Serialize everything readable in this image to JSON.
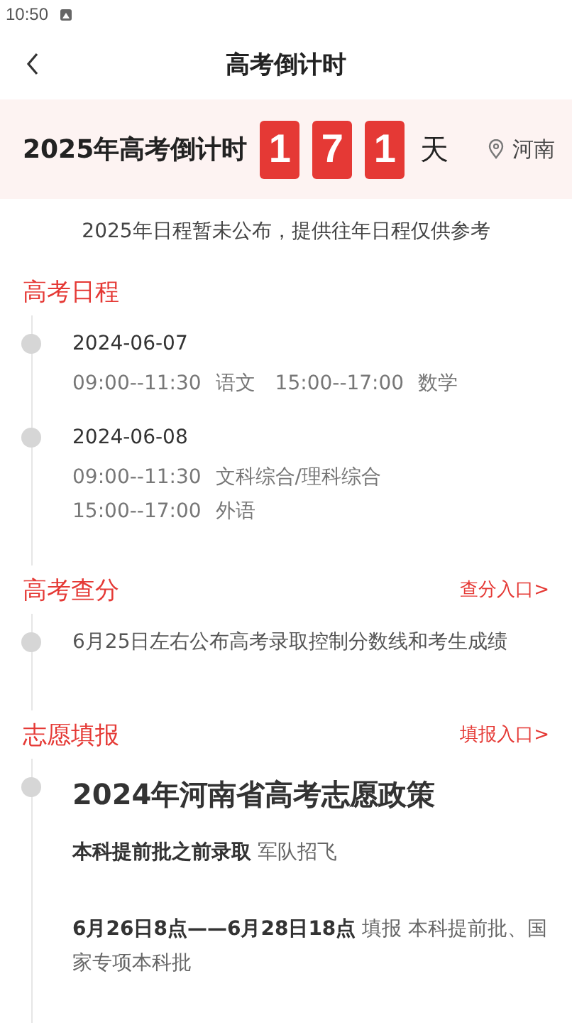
{
  "status_bar": {
    "time": "10:50"
  },
  "header": {
    "title": "高考倒计时"
  },
  "countdown": {
    "label": "2025年高考倒计时",
    "digits": [
      "1",
      "7",
      "1"
    ],
    "unit": "天",
    "location": "河南"
  },
  "notice": "2025年日程暂未公布，提供往年日程仅供参考",
  "sections": [
    {
      "title": "高考日程",
      "items": [
        {
          "kind": "schedule",
          "date": "2024-06-07",
          "sessions": [
            {
              "time": "09:00--11:30",
              "subject": "语文"
            },
            {
              "time": "15:00--17:00",
              "subject": "数学"
            }
          ]
        },
        {
          "kind": "schedule",
          "date": "2024-06-08",
          "sessions": [
            {
              "time": "09:00--11:30",
              "subject": "文科综合/理科综合"
            },
            {
              "time": "15:00--17:00",
              "subject": "外语"
            }
          ]
        }
      ]
    },
    {
      "title": "高考查分",
      "link": "查分入口>",
      "items": [
        {
          "kind": "text",
          "text": "6月25日左右公布高考录取控制分数线和考生成绩"
        }
      ]
    },
    {
      "title": "志愿填报",
      "link": "填报入口>",
      "items": [
        {
          "kind": "policy",
          "title": "2024年河南省高考志愿政策",
          "entries": [
            "**本科提前批之前录取** 军队招飞",
            "**6月26日8点——6月28日18点** 填报 本科提前批、国家专项本科批"
          ]
        }
      ]
    }
  ]
}
